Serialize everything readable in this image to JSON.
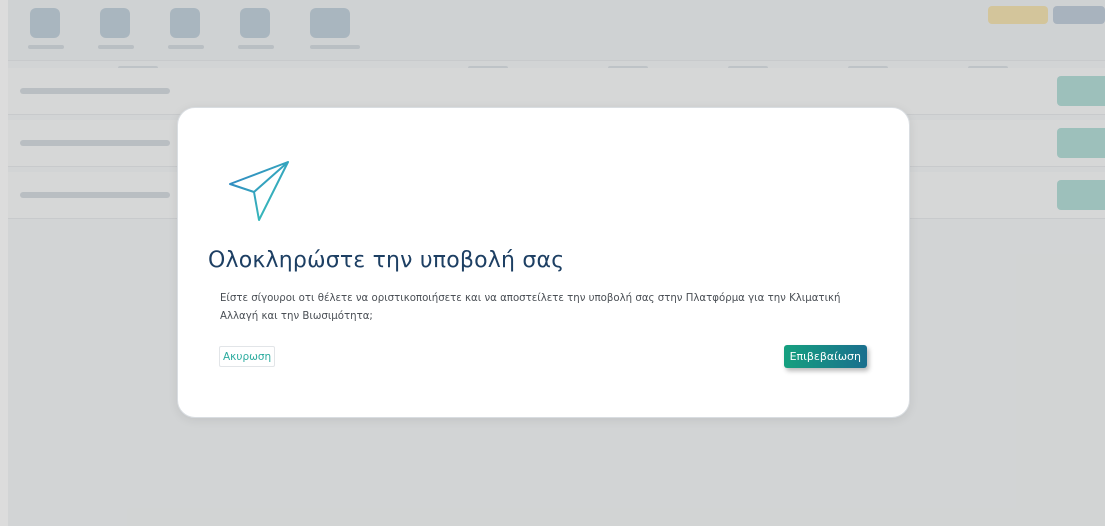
{
  "dialog": {
    "title": "Ολοκληρώστε την υποβολή σας",
    "message": "Είστε σίγουροι οτι θέλετε να οριστικοποιήσετε και να αποστείλετε την υποβολή σας στην Πλατφόρμα για την Κλιματική Αλλαγή και την Βιωσιμότητα;",
    "cancel_label": "Ακυρωση",
    "confirm_label": "Επιβεβαίωση",
    "icon": "paper-plane-send-icon"
  },
  "colors": {
    "title": "#1d3f63",
    "accent": "#2bab9e",
    "confirm_gradient_start": "#15a07f",
    "confirm_gradient_end": "#1a6f8e",
    "icon_gradient_start": "#2f7fc4",
    "icon_gradient_end": "#39c9b7",
    "overlay": "rgba(128,128,128,0.28)"
  }
}
